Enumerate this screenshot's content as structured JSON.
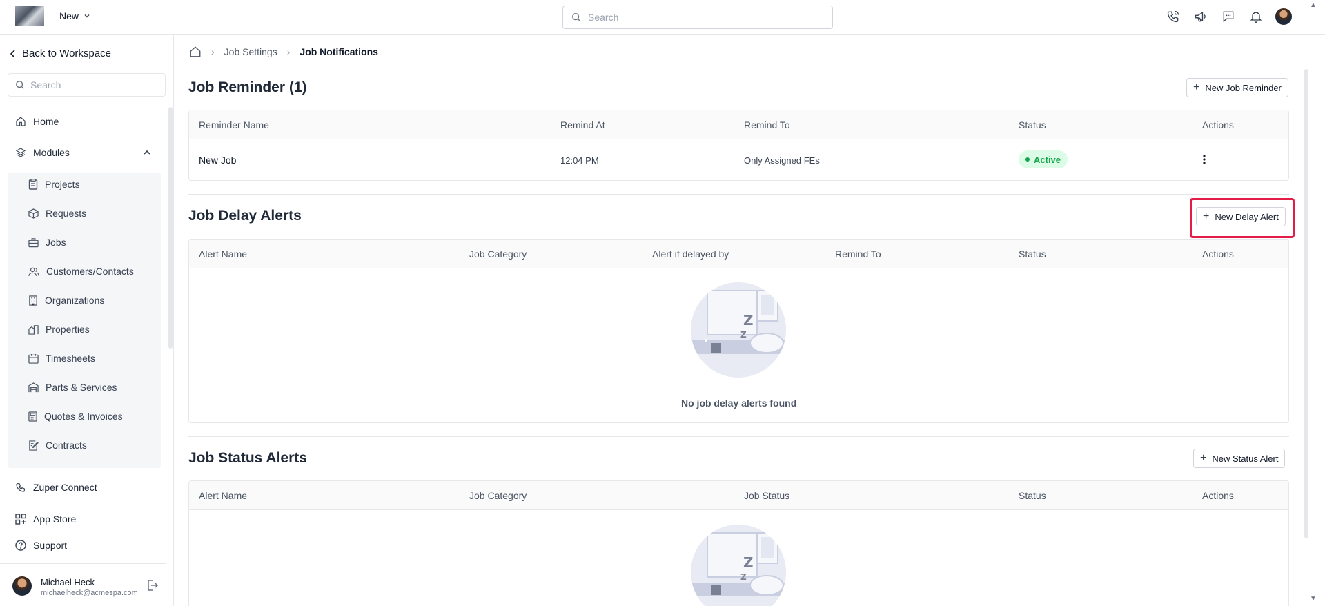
{
  "topbar": {
    "new_label": "New",
    "search_placeholder": "Search",
    "icons": [
      "phone-icon",
      "megaphone-icon",
      "chat-icon",
      "bell-icon",
      "user-avatar"
    ]
  },
  "sidebar": {
    "back_label": "Back to Workspace",
    "search_placeholder": "Search",
    "home": "Home",
    "modules": "Modules",
    "module_items": [
      "Projects",
      "Requests",
      "Jobs",
      "Customers/Contacts",
      "Organizations",
      "Properties",
      "Timesheets",
      "Parts & Services",
      "Quotes & Invoices",
      "Contracts"
    ],
    "bottom_items": [
      "Zuper Connect",
      "App Store",
      "Support"
    ],
    "user": {
      "name": "Michael Heck",
      "email": "michaelheck@acmespa.com"
    }
  },
  "breadcrumb": {
    "items": [
      "Job Settings",
      "Job Notifications"
    ]
  },
  "reminders": {
    "title": "Job Reminder (1)",
    "button_label": "New Job Reminder",
    "headers": [
      "Reminder Name",
      "Remind At",
      "Remind To",
      "Status",
      "Actions"
    ],
    "rows": [
      {
        "name": "New Job",
        "remind_at": "12:04 PM",
        "remind_to": "Only Assigned FEs",
        "status": "Active"
      }
    ]
  },
  "delay_alerts": {
    "title": "Job Delay Alerts",
    "button_label": "New Delay Alert",
    "headers": [
      "Alert Name",
      "Job Category",
      "Alert if delayed by",
      "Remind To",
      "Status",
      "Actions"
    ],
    "empty_text": "No job delay alerts found"
  },
  "status_alerts": {
    "title": "Job Status Alerts",
    "button_label": "New Status Alert",
    "headers": [
      "Alert Name",
      "Job Category",
      "Job Status",
      "Status",
      "Actions"
    ]
  },
  "colors": {
    "accent_highlight": "#e11d48",
    "active_badge_bg": "#dcfce7",
    "active_badge_text": "#16a34a"
  }
}
